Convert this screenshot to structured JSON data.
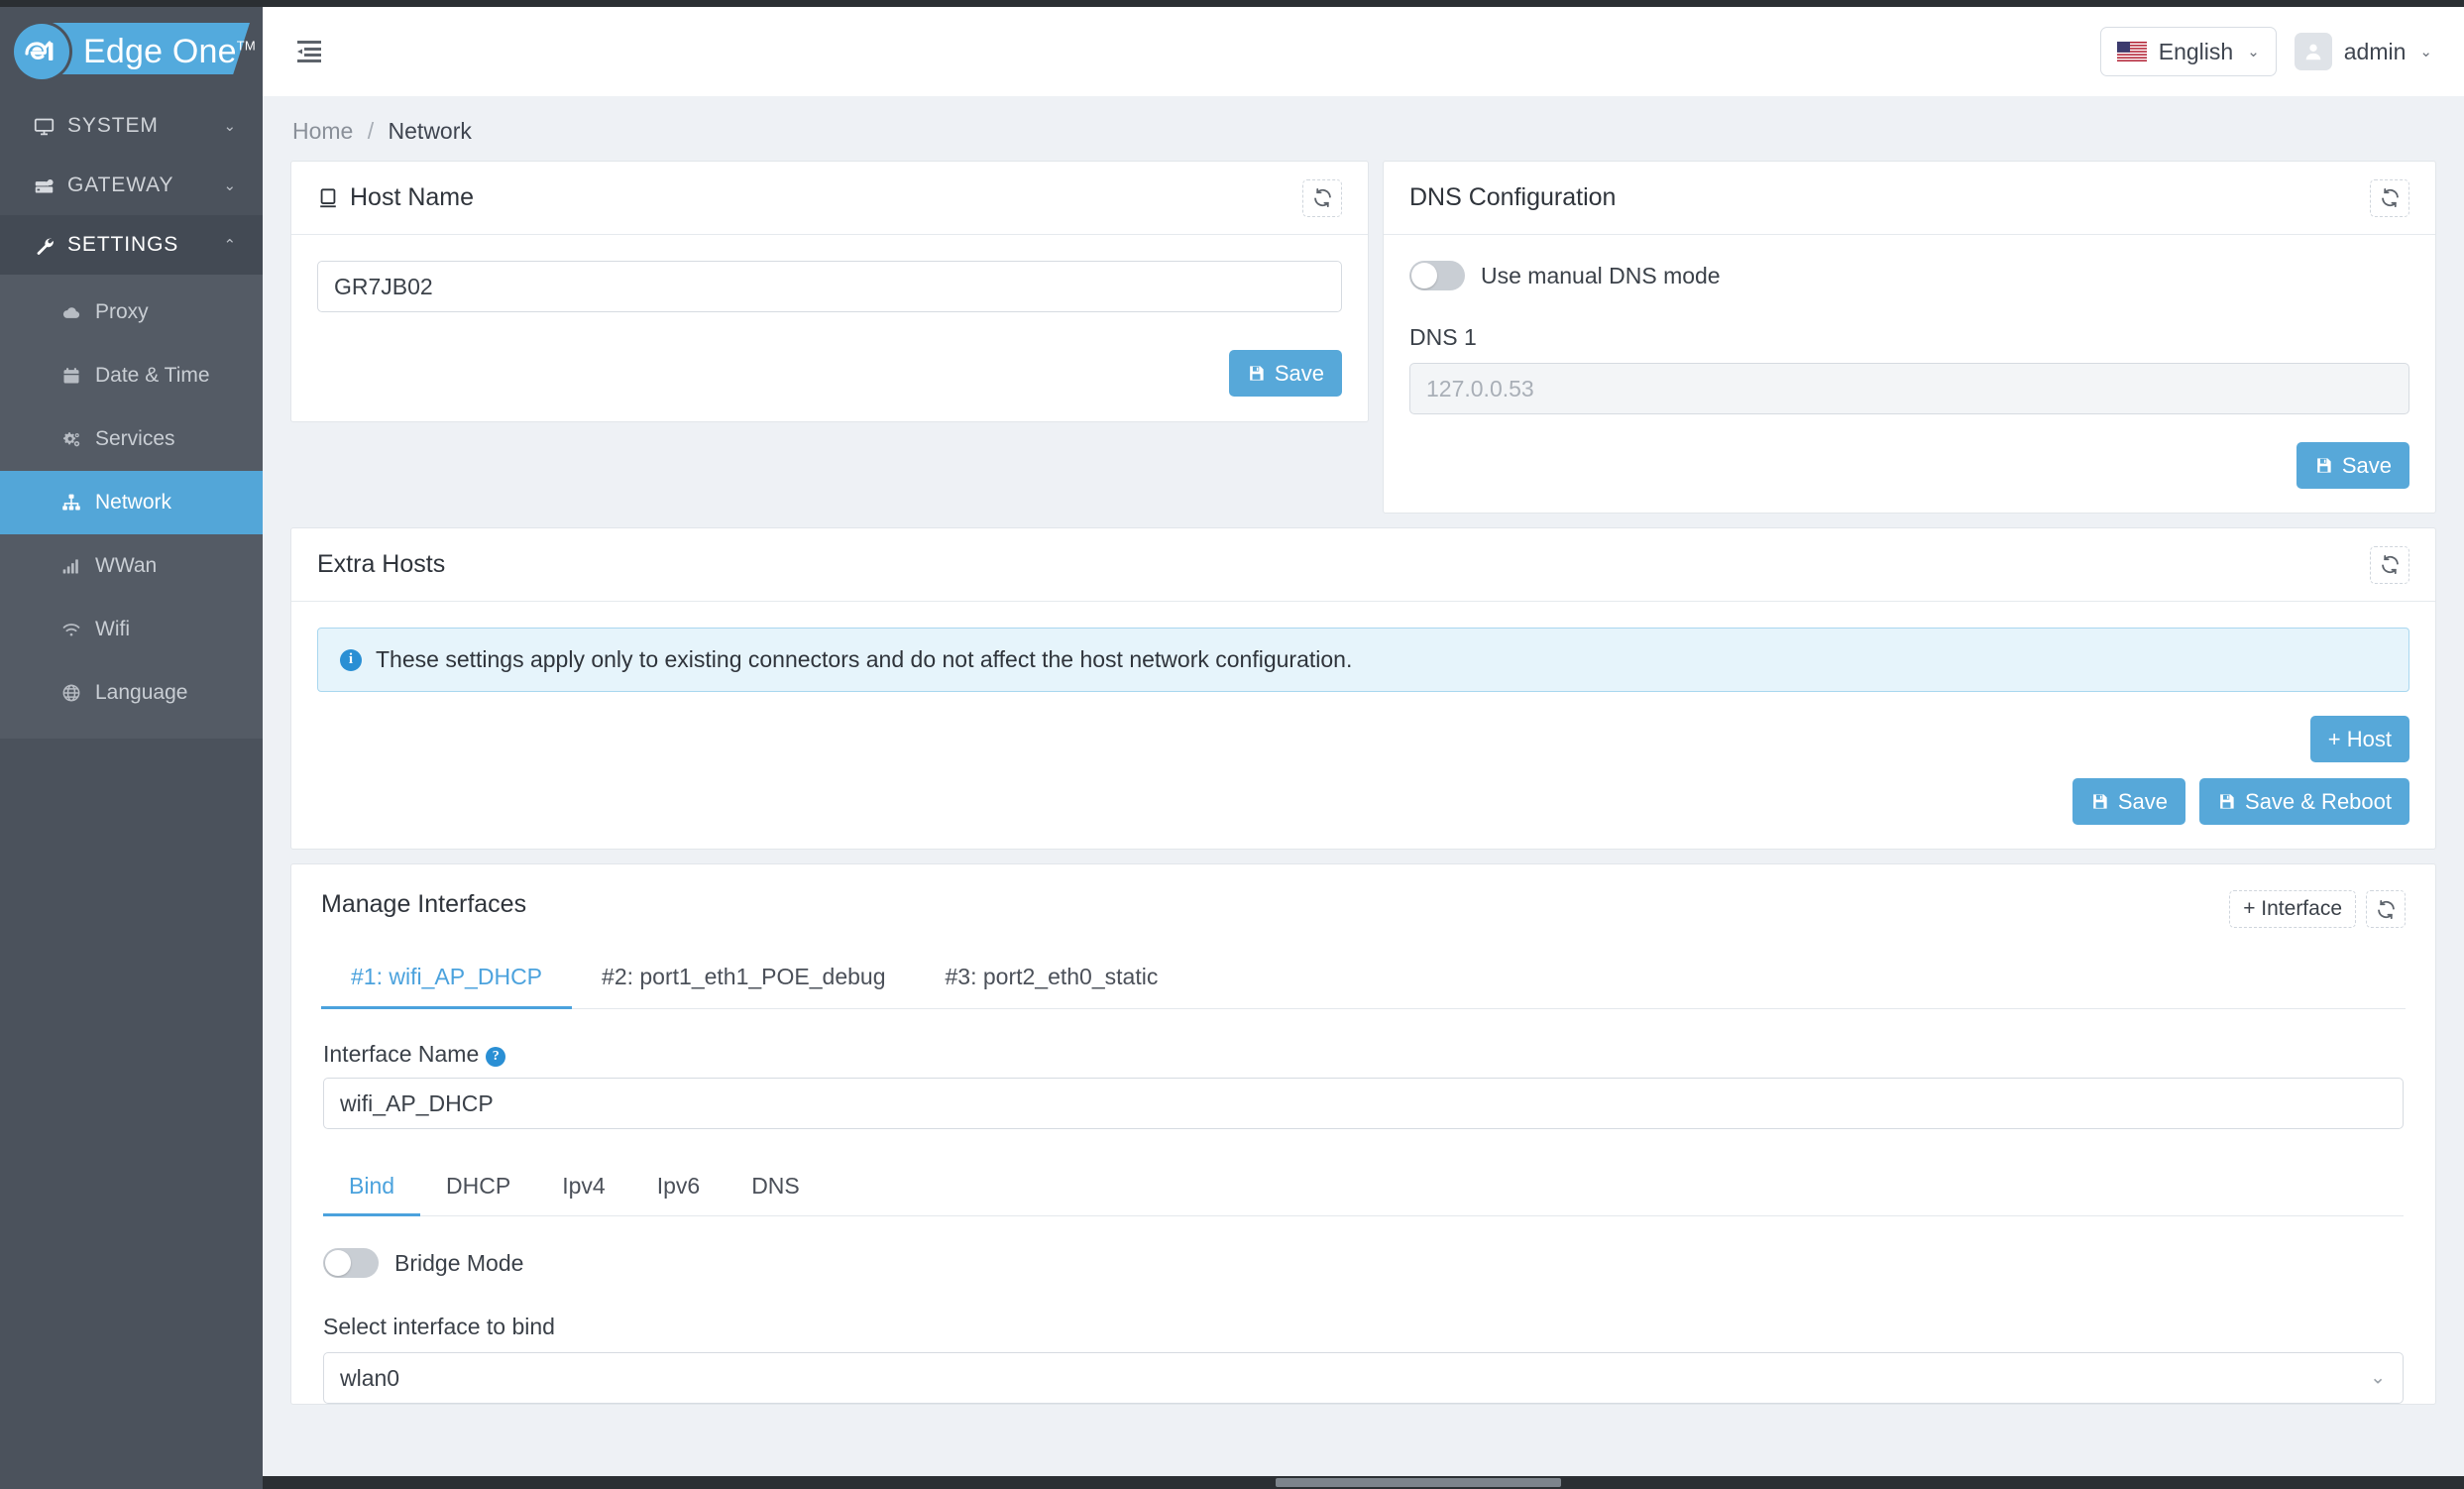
{
  "brand": {
    "name": "Edge One",
    "tm": "TM",
    "mark": "e1-logo-icon"
  },
  "sidebar": {
    "groups": [
      {
        "label": "SYSTEM",
        "icon": "monitor-icon",
        "caret": "⌄",
        "expanded": false
      },
      {
        "label": "GATEWAY",
        "icon": "server-icon",
        "caret": "⌄",
        "expanded": false
      },
      {
        "label": "SETTINGS",
        "icon": "wrench-icon",
        "caret": "⌃",
        "expanded": true
      }
    ],
    "items": [
      {
        "label": "Proxy",
        "icon": "cloud-icon",
        "selected": false
      },
      {
        "label": "Date & Time",
        "icon": "calendar-icon",
        "selected": false
      },
      {
        "label": "Services",
        "icon": "gears-icon",
        "selected": false
      },
      {
        "label": "Network",
        "icon": "sitemap-icon",
        "selected": true
      },
      {
        "label": "WWan",
        "icon": "signal-bars-icon",
        "selected": false
      },
      {
        "label": "Wifi",
        "icon": "wifi-icon",
        "selected": false
      },
      {
        "label": "Language",
        "icon": "globe-icon",
        "selected": false
      }
    ]
  },
  "topbar": {
    "menu_toggle": "collapse-sidebar-icon",
    "language": "English",
    "language_caret": "⌄",
    "user": "admin",
    "user_caret": "⌄"
  },
  "breadcrumb": {
    "home": "Home",
    "separator": "/",
    "current": "Network"
  },
  "host_name_card": {
    "title": "Host Name",
    "title_icon": "desktop-icon",
    "refresh_icon": "refresh-icon",
    "value": "GR7JB02",
    "save_label": "Save"
  },
  "dns_card": {
    "title": "DNS Configuration",
    "refresh_icon": "refresh-icon",
    "toggle_label": "Use manual DNS mode",
    "toggle_on": false,
    "dns1_label": "DNS 1",
    "dns1_value": "127.0.0.53",
    "dns1_disabled": true,
    "save_label": "Save"
  },
  "extra_hosts_card": {
    "title": "Extra Hosts",
    "refresh_icon": "refresh-icon",
    "info_icon": "info-circle-icon",
    "info_text": "These settings apply only to existing connectors and do not affect the host network configuration.",
    "add_host_label": "+ Host",
    "save_label": "Save",
    "save_reboot_label": "Save & Reboot"
  },
  "manage_interfaces": {
    "title": "Manage Interfaces",
    "add_interface_label": "+ Interface",
    "refresh_icon": "refresh-icon",
    "tabs": [
      {
        "label": "#1: wifi_AP_DHCP",
        "active": true
      },
      {
        "label": "#2: port1_eth1_POE_debug",
        "active": false
      },
      {
        "label": "#3: port2_eth0_static",
        "active": false
      }
    ],
    "interface_name_label": "Interface Name",
    "interface_name_help": "?",
    "interface_name_value": "wifi_AP_DHCP",
    "subtabs": [
      {
        "label": "Bind",
        "active": true
      },
      {
        "label": "DHCP",
        "active": false
      },
      {
        "label": "Ipv4",
        "active": false
      },
      {
        "label": "Ipv6",
        "active": false
      },
      {
        "label": "DNS",
        "active": false
      }
    ],
    "bridge_mode_label": "Bridge Mode",
    "bridge_mode_on": false,
    "select_label": "Select interface to bind",
    "select_value": "wlan0",
    "select_caret": "⌄"
  },
  "colors": {
    "accent": "#53a6d8",
    "sidebar_bg": "#4b525c",
    "sidebar_sub_bg": "#545b65",
    "page_bg": "#eef1f5",
    "info_bg": "#e6f4fb",
    "info_border": "#a9d7ef"
  }
}
